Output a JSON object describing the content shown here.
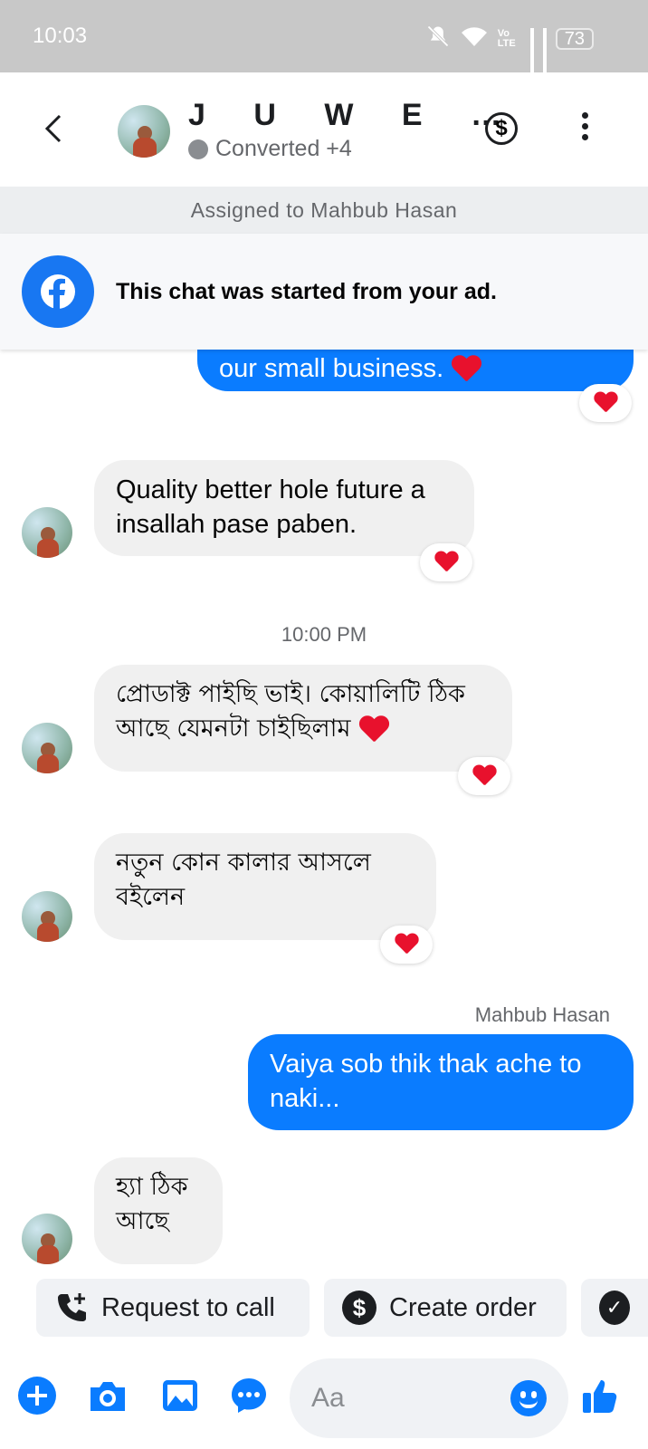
{
  "status_bar": {
    "time": "10:03",
    "network_label": "Vo\nLTE",
    "battery": "73"
  },
  "header": {
    "contact_name": "J U W E …",
    "contact_status": "Converted +4"
  },
  "assigned_text": "Assigned to Mahbub Hasan",
  "ad_banner_text": "This chat was started from your ad.",
  "messages": [
    {
      "direction": "outgoing",
      "text": "our small business.",
      "reaction": "heart"
    },
    {
      "direction": "incoming",
      "text": "Quality better hole future a insallah pase paben.",
      "reaction": "heart"
    },
    {
      "direction": "incoming",
      "text": "প্রোডাক্ট পাইছি ভাই। কোয়ালিটি ঠিক আছে যেমনটা চাইছিলাম",
      "reaction": "heart"
    },
    {
      "direction": "incoming",
      "text": "নতুন কোন কালার আসলে বইলেন",
      "reaction": "heart"
    },
    {
      "direction": "outgoing",
      "sender": "Mahbub Hasan",
      "text": "Vaiya sob thik thak ache to naki..."
    },
    {
      "direction": "incoming",
      "text": "হ্যা ঠিক আছে"
    }
  ],
  "time_separator": "10:00 PM",
  "quick_actions": [
    {
      "label": "Request to call",
      "icon": "phone-plus-icon"
    },
    {
      "label": "Create order",
      "icon": "dollar-icon"
    },
    {
      "label": "",
      "icon": "check-icon"
    }
  ],
  "composer": {
    "placeholder": "Aa"
  },
  "colors": {
    "accent": "#0a7cff",
    "facebook": "#1877f2",
    "heart": "#e8112d"
  }
}
